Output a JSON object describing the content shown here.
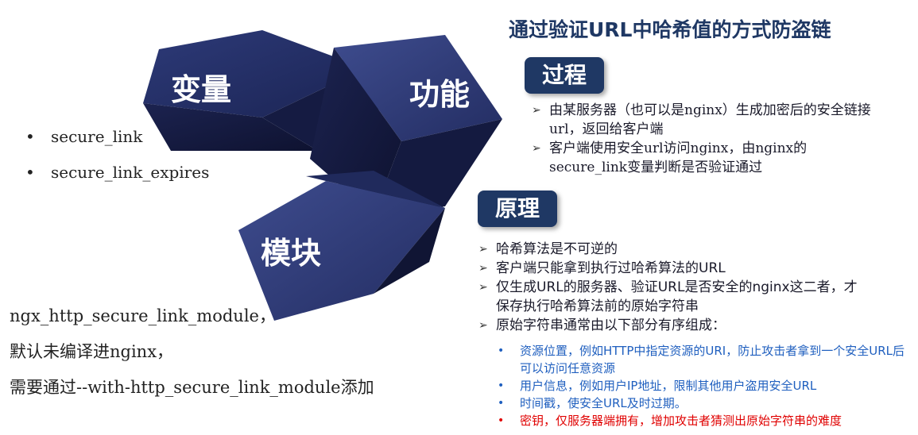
{
  "title": "通过验证URL中哈希值的方式防盗链",
  "cubes": {
    "variables": "变量",
    "function": "功能",
    "module": "模块"
  },
  "process": {
    "badge": "过程",
    "items": [
      "由某服务器（也可以是nginx）生成加密后的安全链接url，返回给客户端",
      "客户端使用安全url访问nginx，由nginx的secure_link变量判断是否验证通过"
    ]
  },
  "principle": {
    "badge": "原理",
    "items": [
      "哈希算法是不可逆的",
      "客户端只能拿到执行过哈希算法的URL",
      "仅生成URL的服务器、验证URL是否安全的nginx这二者，才保存执行哈希算法前的原始字符串",
      "原始字符串通常由以下部分有序组成："
    ],
    "components": [
      "资源位置，例如HTTP中指定资源的URI，防止攻击者拿到一个安全URL后可以访问任意资源",
      "用户信息，例如用户IP地址，限制其他用户盗用安全URL",
      "时间戳，使安全URL及时过期。",
      "密钥，仅服务器端拥有，增加攻击者猜测出原始字符串的难度"
    ]
  },
  "variables": [
    "secure_link",
    "secure_link_expires"
  ],
  "module": [
    "ngx_http_secure_link_module，",
    "默认未编译进nginx，",
    "需要通过--with-http_secure_link_module添加"
  ],
  "colors": {
    "navy": "#1f3864",
    "blue_text": "#1f5fbf",
    "red_text": "#e00000"
  }
}
